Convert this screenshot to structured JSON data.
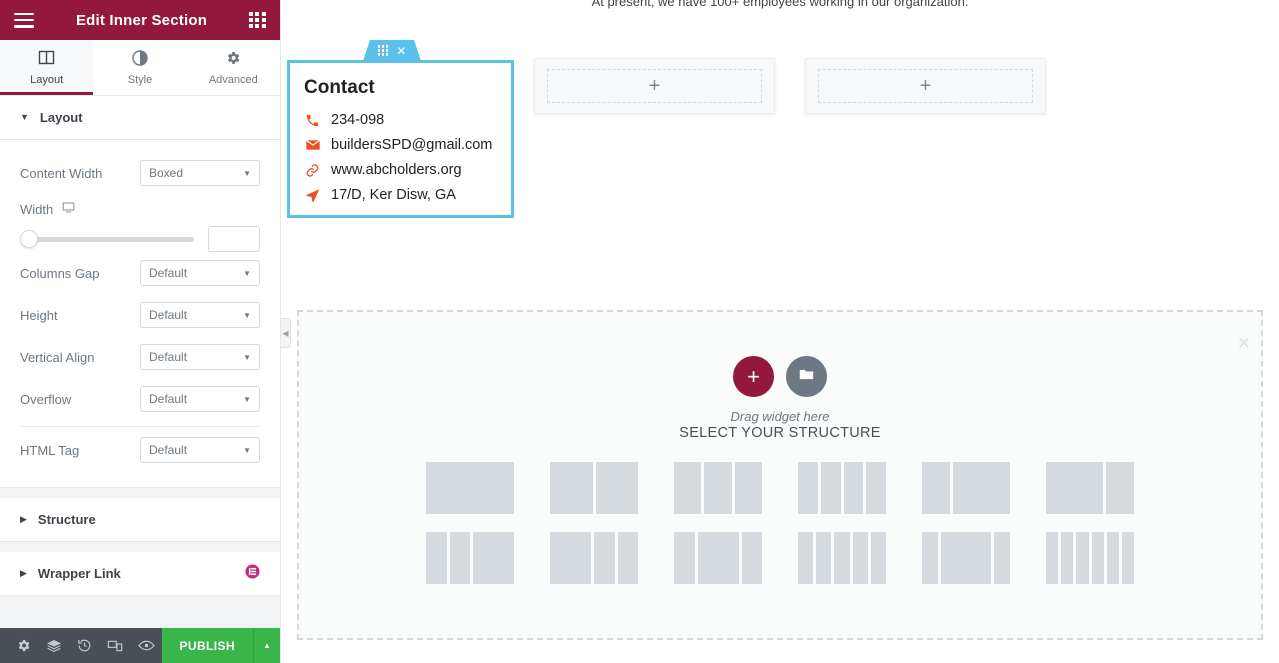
{
  "panel": {
    "header": {
      "title": "Edit Inner Section",
      "menu_icon": "hamburger-icon",
      "apps_icon": "grid-apps-icon"
    },
    "tabs": [
      {
        "label": "Layout",
        "icon": "layout-columns-icon",
        "active": true
      },
      {
        "label": "Style",
        "icon": "contrast-circle-icon",
        "active": false
      },
      {
        "label": "Advanced",
        "icon": "gear-icon",
        "active": false
      }
    ],
    "sections": [
      {
        "id": "layout",
        "title": "Layout",
        "expanded": true
      },
      {
        "id": "structure",
        "title": "Structure",
        "expanded": false
      },
      {
        "id": "wrapper_link",
        "title": "Wrapper Link",
        "expanded": false,
        "badge": "elementor-pro-badge"
      }
    ],
    "controls": [
      {
        "label": "Content Width",
        "type": "select",
        "value": "Boxed"
      },
      {
        "label": "Width",
        "type": "slider",
        "device_icon": "desktop-icon",
        "value": "",
        "slider_position_pct": 0
      },
      {
        "label": "Columns Gap",
        "type": "select",
        "value": "Default"
      },
      {
        "label": "Height",
        "type": "select",
        "value": "Default"
      },
      {
        "label": "Vertical Align",
        "type": "select",
        "value": "Default"
      },
      {
        "label": "Overflow",
        "type": "select",
        "value": "Default"
      },
      {
        "label": "HTML Tag",
        "type": "select",
        "value": "Default"
      }
    ],
    "footer": {
      "icons": [
        "gear-icon",
        "layers-icon",
        "history-revisions-icon",
        "responsive-mode-icon",
        "preview-eye-icon"
      ],
      "publish_label": "PUBLISH",
      "publish_arrow_icon": "chevron-up-icon",
      "publish_color": "#39b54a"
    },
    "colors": {
      "header_bg": "#93183d",
      "footer_bg": "#4a4f55",
      "accent": "#93183d"
    }
  },
  "canvas": {
    "top_text": "At present, we have 100+ employees working in our organization.",
    "collapse_handle_icon": "chevron-left-icon",
    "add_section_boxes": [
      {
        "icon": "plus-icon",
        "label": "+"
      },
      {
        "icon": "plus-icon",
        "label": "+"
      }
    ],
    "contact_card": {
      "tab": {
        "drag_icon": "drag-dots-icon",
        "close_icon": "close-x-icon"
      },
      "title": "Contact",
      "border_color": "#5bc0ea",
      "icon_color": "#f04e23",
      "items": [
        {
          "icon": "phone-icon",
          "text": "234-098"
        },
        {
          "icon": "envelope-icon",
          "text": "buildersSPD@gmail.com"
        },
        {
          "icon": "link-icon",
          "text": "www.abcholders.org"
        },
        {
          "icon": "location-arrow-icon",
          "text": "17/D, Ker Disw, GA"
        }
      ]
    },
    "drop_zone": {
      "close_icon": "close-x-icon",
      "add_button_icon": "plus-icon",
      "template_button_icon": "folder-icon",
      "hint": "Drag widget here",
      "title": "SELECT YOUR STRUCTURE",
      "add_button_color": "#93183d",
      "template_button_color": "#6d7882",
      "preset_rows": [
        [
          {
            "name": "1-column",
            "fractions": [
              1
            ]
          },
          {
            "name": "2-columns-equal",
            "fractions": [
              1,
              1
            ]
          },
          {
            "name": "3-columns-equal",
            "fractions": [
              1,
              1,
              1
            ]
          },
          {
            "name": "4-columns-equal",
            "fractions": [
              1,
              1,
              1,
              1
            ]
          },
          {
            "name": "33-66",
            "fractions": [
              1,
              2
            ]
          },
          {
            "name": "66-33",
            "fractions": [
              2,
              1
            ]
          }
        ],
        [
          {
            "name": "25-25-50",
            "fractions": [
              1,
              1,
              2
            ]
          },
          {
            "name": "50-25-25",
            "fractions": [
              2,
              1,
              1
            ]
          },
          {
            "name": "25-50-25",
            "fractions": [
              1,
              2,
              1
            ]
          },
          {
            "name": "5-columns-equal",
            "fractions": [
              1,
              1,
              1,
              1,
              1
            ]
          },
          {
            "name": "20-60-20",
            "fractions": [
              1,
              3,
              1
            ]
          },
          {
            "name": "6-columns-equal",
            "fractions": [
              1,
              1,
              1,
              1,
              1,
              1
            ]
          }
        ]
      ]
    }
  }
}
